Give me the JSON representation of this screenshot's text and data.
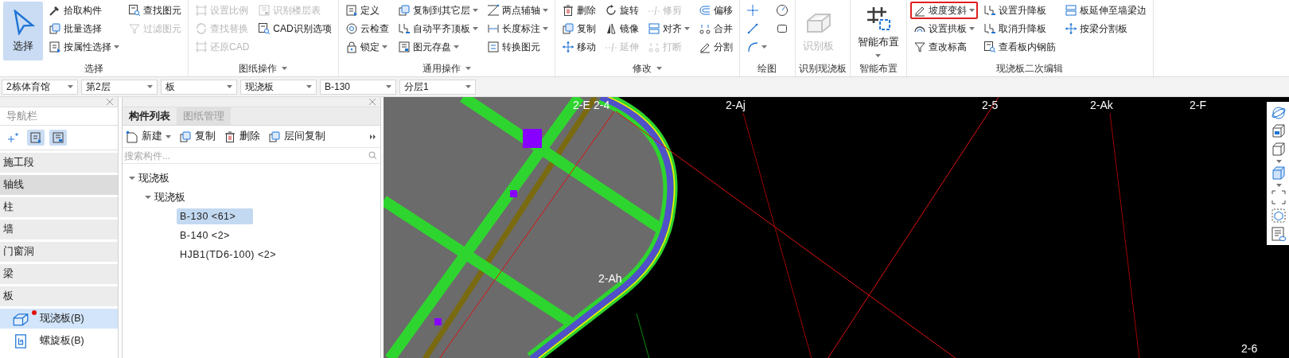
{
  "ribbon": {
    "groups": [
      {
        "label": "选择",
        "has_menu": false,
        "large": {
          "label": "选择",
          "selected": true,
          "disabled": false,
          "dropdown": false
        },
        "columns": [
          [
            {
              "label": "拾取构件",
              "disabled": false,
              "dropdown": false
            },
            {
              "label": "批量选择",
              "disabled": false,
              "dropdown": false
            },
            {
              "label": "按属性选择",
              "disabled": false,
              "dropdown": true
            }
          ],
          [
            {
              "label": "查找图元",
              "disabled": false,
              "dropdown": false
            },
            {
              "label": "过滤图元",
              "disabled": true,
              "dropdown": false
            }
          ]
        ]
      },
      {
        "label": "图纸操作",
        "has_menu": true,
        "columns": [
          [
            {
              "label": "设置比例",
              "disabled": true,
              "dropdown": false
            },
            {
              "label": "查找替换",
              "disabled": true,
              "dropdown": false
            },
            {
              "label": "还原CAD",
              "disabled": true,
              "dropdown": false
            }
          ],
          [
            {
              "label": "识别楼层表",
              "disabled": true,
              "dropdown": false
            },
            {
              "label": "CAD识别选项",
              "disabled": false,
              "dropdown": false
            }
          ]
        ]
      },
      {
        "label": "通用操作",
        "has_menu": true,
        "columns": [
          [
            {
              "label": "定义",
              "disabled": false,
              "dropdown": false
            },
            {
              "label": "云检查",
              "disabled": false,
              "dropdown": false
            },
            {
              "label": "锁定",
              "disabled": false,
              "dropdown": true
            }
          ],
          [
            {
              "label": "复制到其它层",
              "disabled": false,
              "dropdown": true
            },
            {
              "label": "自动平齐顶板",
              "disabled": false,
              "dropdown": true
            },
            {
              "label": "图元存盘",
              "disabled": false,
              "dropdown": true
            }
          ],
          [
            {
              "label": "两点辅轴",
              "disabled": false,
              "dropdown": true
            },
            {
              "label": "长度标注",
              "disabled": false,
              "dropdown": true
            },
            {
              "label": "转换图元",
              "disabled": false,
              "dropdown": false
            }
          ]
        ]
      },
      {
        "label": "修改",
        "has_menu": true,
        "columns": [
          [
            {
              "label": "删除",
              "disabled": false,
              "dropdown": false
            },
            {
              "label": "复制",
              "disabled": false,
              "dropdown": false
            },
            {
              "label": "移动",
              "disabled": false,
              "dropdown": false
            }
          ],
          [
            {
              "label": "旋转",
              "disabled": false,
              "dropdown": false
            },
            {
              "label": "镜像",
              "disabled": false,
              "dropdown": false
            },
            {
              "label": "延伸",
              "disabled": true,
              "dropdown": false
            }
          ],
          [
            {
              "label": "修剪",
              "disabled": true,
              "dropdown": false
            },
            {
              "label": "对齐",
              "disabled": false,
              "dropdown": true
            },
            {
              "label": "打断",
              "disabled": true,
              "dropdown": false
            }
          ],
          [
            {
              "label": "偏移",
              "disabled": false,
              "dropdown": false
            },
            {
              "label": "合并",
              "disabled": false,
              "dropdown": false
            },
            {
              "label": "分割",
              "disabled": false,
              "dropdown": false
            }
          ]
        ]
      },
      {
        "label": "绘图",
        "has_menu": false,
        "columns": [
          [
            {
              "disabled": false,
              "dropdown": false
            },
            {
              "disabled": false,
              "dropdown": false
            },
            {
              "disabled": false,
              "dropdown": true
            }
          ],
          [
            {
              "disabled": false,
              "dropdown": false
            },
            {
              "disabled": false,
              "dropdown": false
            }
          ]
        ]
      },
      {
        "label": "识别现浇板",
        "has_menu": false,
        "large": {
          "label": "识别板",
          "selected": false,
          "disabled": true,
          "dropdown": false
        }
      },
      {
        "label": "智能布置",
        "has_menu": false,
        "large": {
          "label": "智能布置",
          "selected": false,
          "disabled": false,
          "dropdown": true
        }
      },
      {
        "label": "现浇板二次编辑",
        "has_menu": false,
        "columns": [
          [
            {
              "label": "坡度变斜",
              "disabled": false,
              "dropdown": true,
              "highlighted": true
            },
            {
              "label": "设置拱板",
              "disabled": false,
              "dropdown": true,
              "highlighted": false
            },
            {
              "label": "查改标高",
              "disabled": false,
              "dropdown": false,
              "highlighted": false
            }
          ],
          [
            {
              "label": "设置升降板",
              "disabled": false,
              "dropdown": false,
              "highlighted": false
            },
            {
              "label": "取消升降板",
              "disabled": false,
              "dropdown": false,
              "highlighted": false
            },
            {
              "label": "查看板内钢筋",
              "disabled": false,
              "dropdown": false,
              "highlighted": false
            }
          ],
          [
            {
              "label": "板延伸至墙梁边",
              "disabled": false,
              "dropdown": false,
              "highlighted": false
            },
            {
              "label": "按梁分割板",
              "disabled": false,
              "dropdown": false,
              "highlighted": false
            }
          ]
        ]
      }
    ]
  },
  "selectors": [
    {
      "value": "2栋体育馆"
    },
    {
      "value": "第2层"
    },
    {
      "value": "板"
    },
    {
      "value": "现浇板"
    },
    {
      "value": "B-130"
    },
    {
      "value": "分层1"
    }
  ],
  "navigator": {
    "title": "导航栏",
    "view_buttons": [
      {
        "selected": false
      },
      {
        "selected": true
      },
      {
        "selected": true
      }
    ],
    "items": [
      {
        "label": "施工段",
        "hovered": false
      },
      {
        "label": "轴线",
        "hovered": true
      },
      {
        "label": "柱",
        "hovered": false
      },
      {
        "label": "墙",
        "hovered": false
      },
      {
        "label": "门窗洞",
        "hovered": false
      },
      {
        "label": "梁",
        "hovered": false
      },
      {
        "label": "板",
        "hovered": false,
        "children": [
          {
            "label": "现浇板(B)",
            "selected": true,
            "flagged": true
          },
          {
            "label": "螺旋板(B)",
            "selected": false,
            "flagged": false
          }
        ]
      }
    ]
  },
  "component_panel": {
    "tabs": [
      {
        "label": "构件列表",
        "selected": true
      },
      {
        "label": "图纸管理",
        "selected": false
      }
    ],
    "actions": [
      {
        "label": "新建",
        "dropdown": true
      },
      {
        "label": "复制",
        "dropdown": false
      },
      {
        "label": "删除",
        "dropdown": false
      },
      {
        "label": "层间复制",
        "dropdown": false
      }
    ],
    "search": {
      "placeholder": "搜索构件..."
    },
    "tree": [
      {
        "label": "现浇板",
        "expanded": true,
        "children": [
          {
            "label": "现浇板",
            "expanded": true,
            "children": [
              {
                "label": "B-130 <61>",
                "selected": true
              },
              {
                "label": "B-140 <2>",
                "selected": false
              },
              {
                "label": "HJB1(TD6-100) <2>",
                "selected": false
              }
            ]
          }
        ]
      }
    ]
  },
  "canvas": {
    "axis_labels": [
      {
        "text": "2-E"
      },
      {
        "text": "2-4"
      },
      {
        "text": "2-Aj"
      },
      {
        "text": "2-5"
      },
      {
        "text": "2-Ak"
      },
      {
        "text": "2-F"
      },
      {
        "text": "2-Ah"
      },
      {
        "text": "2-6"
      }
    ]
  }
}
